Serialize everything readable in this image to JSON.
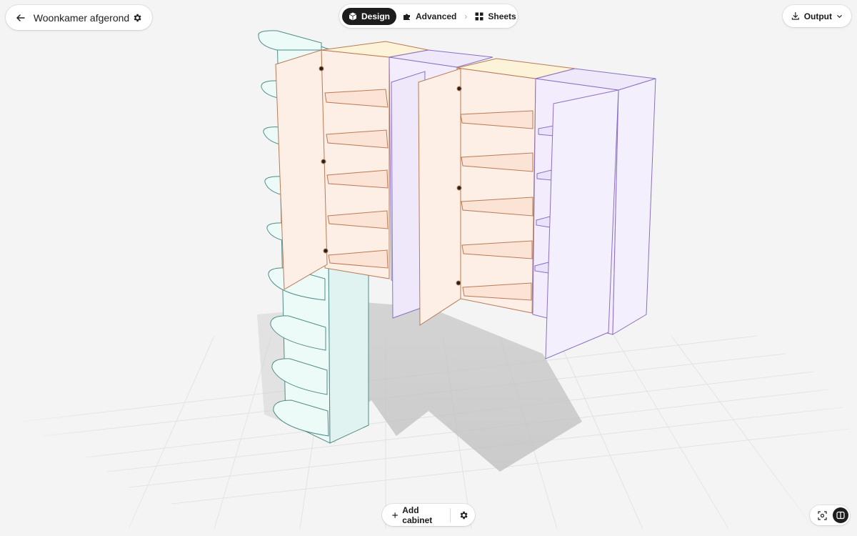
{
  "project": {
    "title": "Woonkamer afgerond"
  },
  "modes": {
    "tabs": [
      {
        "label": "Design",
        "icon": "cube-icon",
        "active": true
      },
      {
        "label": "Advanced",
        "icon": "puzzle-icon",
        "active": false
      },
      {
        "label": "Sheets",
        "icon": "grid-icon",
        "active": false
      }
    ]
  },
  "output": {
    "label": "Output",
    "icon": "download-icon"
  },
  "bottom_bar": {
    "add_label": "Add cabinet",
    "add_icon": "plus-icon",
    "settings_icon": "gear-icon"
  },
  "view_controls": {
    "buttons": [
      {
        "icon": "focus-icon",
        "active": false
      },
      {
        "icon": "split-view-icon",
        "active": true
      }
    ]
  },
  "colors": {
    "door_orange": "#fdeee6",
    "door_orange_edge": "#b97a52",
    "door_purple": "#f2ecfd",
    "door_purple_edge": "#8a6fc4",
    "shelf_teal": "#ecfaf8",
    "shelf_teal_edge": "#4e8c86"
  }
}
